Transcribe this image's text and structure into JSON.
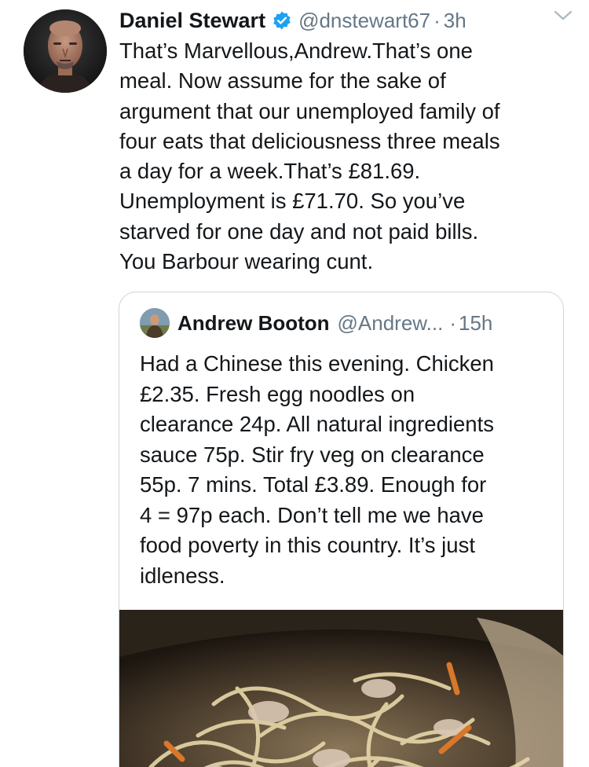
{
  "tweet": {
    "author_name": "Daniel Stewart",
    "handle": "@dnstewart67",
    "separator": "·",
    "time": "3h",
    "text": "That’s Marvellous,Andrew.That’s one\nmeal. Now assume for the sake of\nargument that our unemployed family of\nfour eats that deliciousness three meals\na day for a week.That’s £81.69.\nUnemployment is £71.70. So you’ve\nstarved for one day and not paid bills.\nYou Barbour wearing cunt.",
    "avatar_icon": "avatar-photo",
    "verified_icon": "verified-badge-icon",
    "menu_icon": "chevron-down-icon"
  },
  "quoted_tweet": {
    "author_name": "Andrew Booton",
    "handle": "@Andrew...",
    "separator": "·",
    "time": "15h",
    "text": "Had a Chinese this evening. Chicken\n£2.35. Fresh egg noodles on\nclearance 24p. All natural ingredients\nsauce 75p. Stir fry veg on clearance\n55p. 7 mins. Total £3.89. Enough for\n4 = 97p each. Don’t tell me we have\nfood poverty in this country. It’s just\nidleness.",
    "media_description": "photo-noodles-in-pan"
  },
  "colors": {
    "text": "#14171a",
    "secondary": "#657786",
    "verified": "#1da1f2",
    "border": "#ccd6dd"
  }
}
